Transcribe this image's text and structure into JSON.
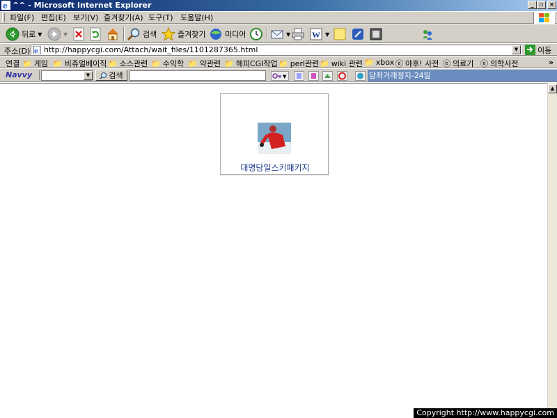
{
  "window": {
    "title": "^^ - Microsoft Internet Explorer"
  },
  "menu": {
    "items": [
      "파일(F)",
      "편집(E)",
      "보기(V)",
      "즐겨찾기(A)",
      "도구(T)",
      "도움말(H)"
    ]
  },
  "toolbar": {
    "back_label": "뒤로",
    "search_label": "검색",
    "favorites_label": "즐겨찾기",
    "media_label": "미디어"
  },
  "address": {
    "label": "주소(D)",
    "url": "http://happycgi.com/Attach/wait_files/1101287365.html",
    "go_label": "이동"
  },
  "links": {
    "label": "연결",
    "items": [
      "게임",
      "비쥬얼베이직",
      "소스관련",
      "수익학",
      "약관련",
      "해피CGI작업",
      "perl관련",
      "wiki 관련",
      "xbox",
      "야후! 사전",
      "의료기",
      "의학사전"
    ]
  },
  "navvy": {
    "logo": "Navvy",
    "search_label": "검색",
    "ticker": "당좌거래정지-24일"
  },
  "content": {
    "ad_caption": "대명당일스키패키지"
  },
  "footer": {
    "copyright": "Copyright  http://www.happycgi.com"
  }
}
